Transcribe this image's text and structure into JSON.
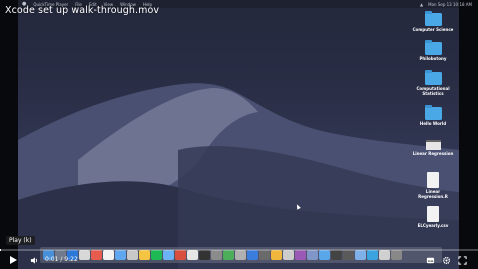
{
  "video": {
    "title": "Xcode set up walk-through.mov",
    "tooltip": "Play (k)",
    "time": "0:01 / 9:22",
    "progress_fraction": 0.002
  },
  "menubar": {
    "items": [
      "QuickTime Player",
      "File",
      "Edit",
      "View",
      "Window",
      "Help"
    ],
    "clock": "Mon Sep 13  10:18 AM"
  },
  "desktop": {
    "icons": [
      {
        "label": "Computer Science",
        "kind": "folder"
      },
      {
        "label": "Philobotony",
        "kind": "folder"
      },
      {
        "label": "Computational Statistics",
        "kind": "folder"
      },
      {
        "label": "Hello World",
        "kind": "folder"
      },
      {
        "label": "Linear Regression",
        "kind": "file"
      },
      {
        "label": "Linear Regression.R",
        "kind": "doc"
      },
      {
        "label": "ELCyearly.csv",
        "kind": "doc"
      }
    ]
  },
  "dock": {
    "app_colors": [
      "#4a90d9",
      "#6f7b8c",
      "#2b78d8",
      "#d8d8d8",
      "#e85c4f",
      "#f2f2f2",
      "#5fa8f0",
      "#c8c8c8",
      "#f4c542",
      "#1db954",
      "#6bb3f5",
      "#d94f3d",
      "#e6e6e6",
      "#333333",
      "#8b8b8b",
      "#4cae5b",
      "#b0b0b0",
      "#3b7ddd",
      "#6a6a6a",
      "#f0b73c",
      "#cccccc",
      "#9b59b6",
      "#8095c8",
      "#59a7e8",
      "#444444",
      "#5a5a5a",
      "#7fb1e8",
      "#3ba3e0",
      "#d0d0d0",
      "#888888"
    ]
  },
  "controls": {
    "play_icon": "play-icon",
    "volume_icon": "volume-icon",
    "right_icons": [
      "settings-icon",
      "subtitles-icon",
      "fullscreen-icon"
    ]
  }
}
